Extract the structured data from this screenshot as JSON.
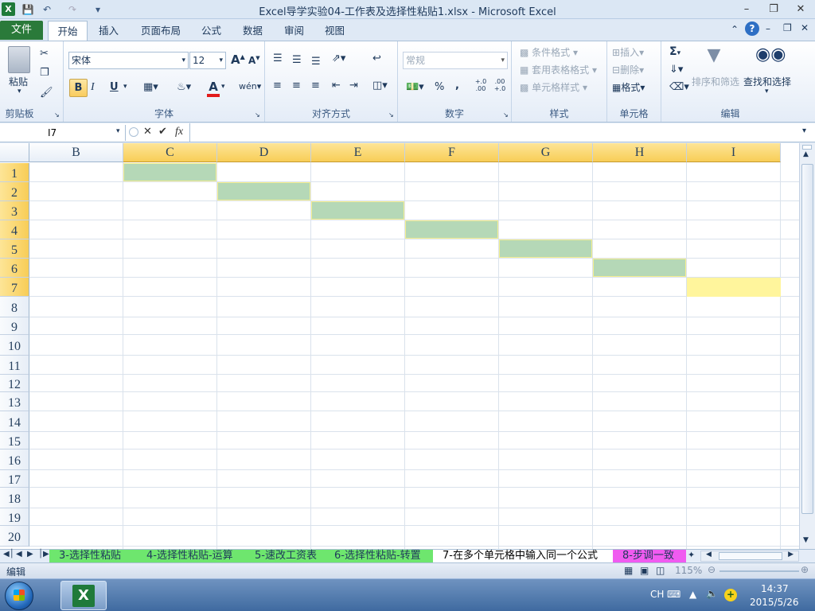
{
  "titlebar": {
    "title": "Excel导学实验04-工作表及选择性粘贴1.xlsx  -  Microsoft Excel"
  },
  "tabs": {
    "file": "文件",
    "home": "开始",
    "insert": "插入",
    "layout": "页面布局",
    "formula": "公式",
    "data": "数据",
    "review": "审阅",
    "view": "视图"
  },
  "ribbon": {
    "clipboard": {
      "paste": "粘贴",
      "label": "剪贴板"
    },
    "font": {
      "name": "宋体",
      "size": "12",
      "label": "字体",
      "bold": "B",
      "italic": "I",
      "underline": "U",
      "font_color_a": "A",
      "wen": "wén",
      "big_a": "A",
      "small_a": "A"
    },
    "align": {
      "label": "对齐方式"
    },
    "number": {
      "format": "常规",
      "label": "数字",
      "percent": "%",
      "comma": ",",
      "inc": "+.0 .00",
      "dec": ".00 +.0"
    },
    "styles": {
      "cond": "条件格式",
      "table": "套用表格格式",
      "cell": "单元格样式",
      "label": "样式"
    },
    "cells": {
      "insert": "插入",
      "delete": "删除",
      "format": "格式",
      "label": "单元格"
    },
    "edit": {
      "sigma": "Σ",
      "sort": "排序和筛选",
      "find": "查找和选择",
      "label": "编辑"
    }
  },
  "formula_bar": {
    "name_box": "I7",
    "fx": "fx",
    "content": ""
  },
  "columns": [
    "B",
    "C",
    "D",
    "E",
    "F",
    "G",
    "H",
    "I"
  ],
  "rows": [
    "1",
    "2",
    "3",
    "4",
    "5",
    "6",
    "7",
    "8",
    "9",
    "10",
    "11",
    "12",
    "13",
    "14",
    "15",
    "16",
    "17",
    "18",
    "19",
    "20"
  ],
  "sheets": [
    "3-选择性粘贴",
    "4-选择性粘贴-运算",
    "5-速改工资表",
    "6-选择性粘贴-转置",
    "7-在多个单元格中输入同一个公式",
    "8-步调一致"
  ],
  "status": {
    "mode": "编辑",
    "zoom": "115%"
  },
  "taskbar": {
    "lang": "CH",
    "time": "14:37",
    "date": "2015/5/26"
  },
  "colors": {
    "selected_header": "#f8cd57",
    "filled_cell": "#b5d8b7",
    "active_cell": "#fff59c",
    "sheet_green": "#6ee66e",
    "sheet_pink": "#f05bf0"
  }
}
